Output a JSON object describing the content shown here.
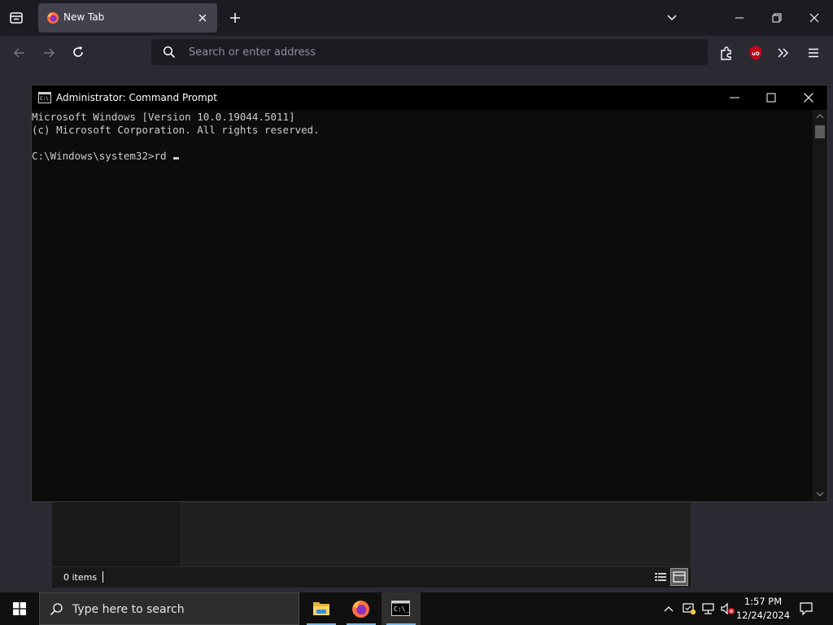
{
  "browser": {
    "tab": {
      "title": "New Tab"
    },
    "address_bar": {
      "placeholder": "Search or enter address",
      "value": ""
    }
  },
  "cmd": {
    "title": "Administrator: Command Prompt",
    "lines": [
      "Microsoft Windows [Version 10.0.19044.5011]",
      "(c) Microsoft Corporation. All rights reserved.",
      "",
      "C:\\Windows\\system32>rd "
    ]
  },
  "explorer": {
    "status": "0 items"
  },
  "taskbar": {
    "search_placeholder": "Type here to search",
    "time": "1:57 PM",
    "date": "12/24/2024",
    "apps": [
      "file-explorer",
      "firefox",
      "command-prompt"
    ]
  },
  "colors": {
    "accent": "#76b9ed",
    "terminal_bg": "#0c0c0c",
    "terminal_fg": "#cccccc",
    "ublock": "#c0091a"
  }
}
